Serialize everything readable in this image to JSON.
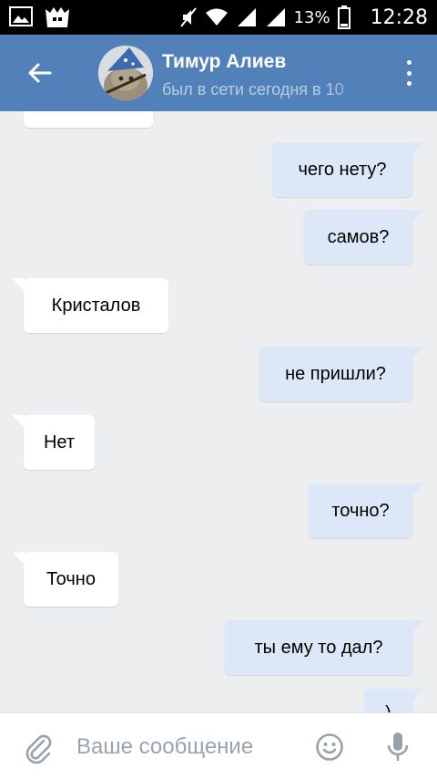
{
  "status_bar": {
    "battery_percent": "13%",
    "time": "12:28",
    "icons": [
      "gallery-icon",
      "app-icon",
      "mute-icon",
      "wifi-icon",
      "signal-icon",
      "signal-icon",
      "battery-icon"
    ]
  },
  "header": {
    "contact_name": "Тимур Алиев",
    "contact_status": "был в сети сегодня в 10",
    "background_color": "#5181b8"
  },
  "messages": [
    {
      "direction": "in",
      "text": ""
    },
    {
      "direction": "out",
      "text": "чего нету?"
    },
    {
      "direction": "out",
      "text": "самов?"
    },
    {
      "direction": "in",
      "text": "Кристалов"
    },
    {
      "direction": "out",
      "text": "не пришли?"
    },
    {
      "direction": "in",
      "text": "Нет"
    },
    {
      "direction": "out",
      "text": "точно?"
    },
    {
      "direction": "in",
      "text": "Точно"
    },
    {
      "direction": "out",
      "text": "ты ему то дал?"
    },
    {
      "direction": "out",
      "text": ")"
    }
  ],
  "composer": {
    "placeholder": "Ваше сообщение",
    "value": ""
  },
  "colors": {
    "incoming_bubble": "#ffffff",
    "outgoing_bubble": "#dce8f7",
    "chat_background": "#edeef0"
  }
}
